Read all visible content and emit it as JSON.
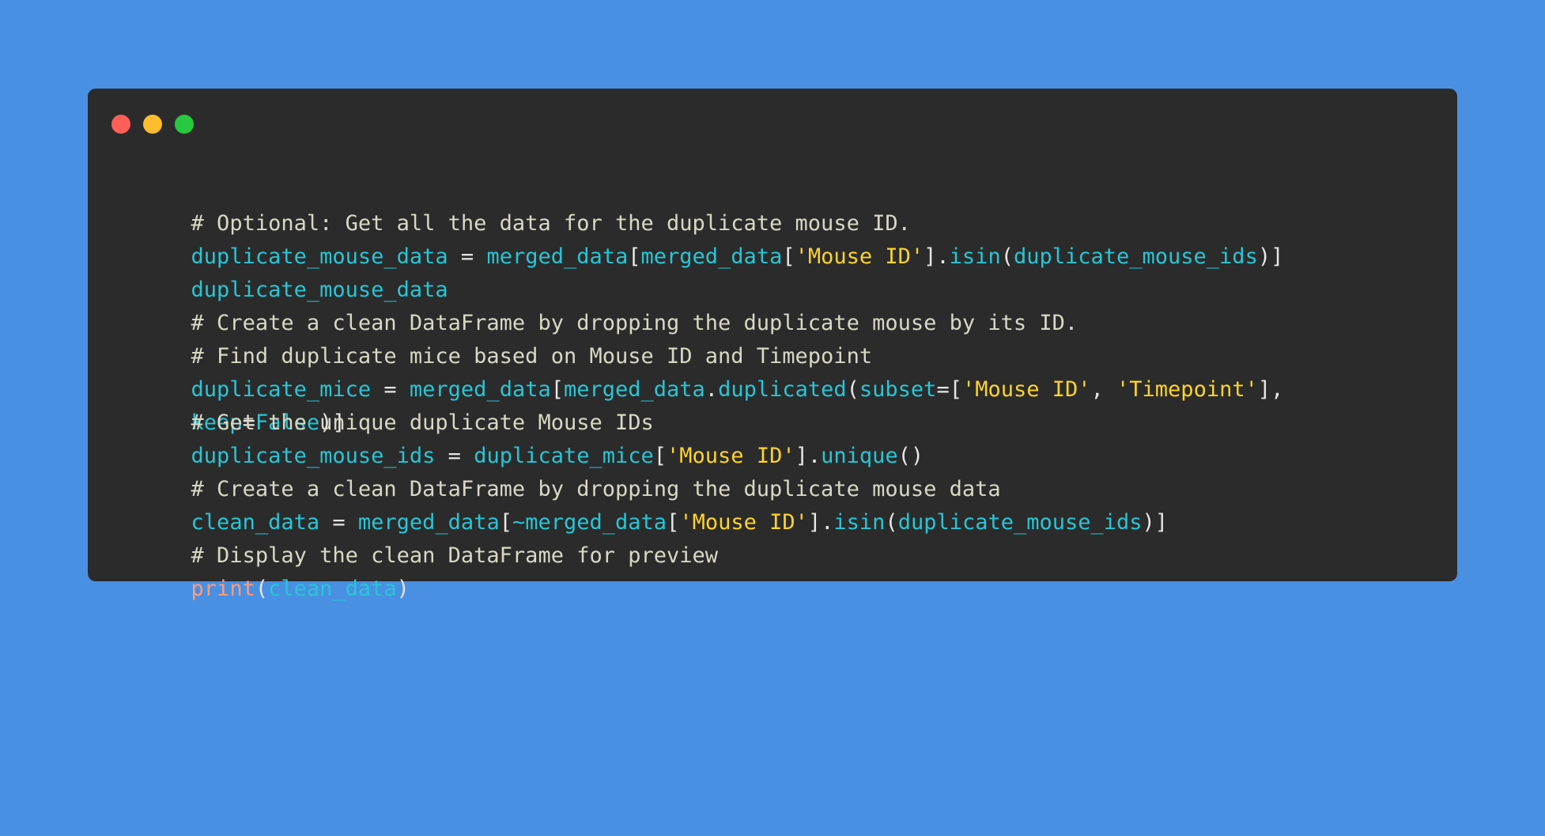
{
  "window": {
    "controls": {
      "close": "close",
      "minimize": "minimize",
      "maximize": "maximize"
    },
    "colors": {
      "background": "#4a90e2",
      "window_bg": "#2b2b2b",
      "comment": "#d8d8c6",
      "identifier": "#27c6d6",
      "string": "#ffd42a",
      "punctuation": "#e6e6e6",
      "function": "#ff9a7a"
    }
  },
  "code": {
    "l1": {
      "comment": "# Optional: Get all the data for the duplicate mouse ID."
    },
    "l2": {
      "a": "duplicate_mouse_data",
      "b": " = ",
      "c": "merged_data",
      "d": "[",
      "e": "merged_data",
      "f": "[",
      "g": "'Mouse ID'",
      "h": "].",
      "i": "isin",
      "j": "(",
      "k": "duplicate_mouse_ids",
      "l": ")]"
    },
    "l3": {
      "a": "duplicate_mouse_data"
    },
    "l4": {
      "comment": "# Create a clean DataFrame by dropping the duplicate mouse by its ID."
    },
    "l5": {
      "comment": "# Find duplicate mice based on Mouse ID and Timepoint"
    },
    "l6": {
      "a": "duplicate_mice",
      "b": " = ",
      "c": "merged_data",
      "d": "[",
      "e": "merged_data",
      "f": ".",
      "g": "duplicated",
      "h": "(",
      "i": "subset",
      "j": "=[",
      "k": "'Mouse ID'",
      "l": ", ",
      "m": "'Timepoint'",
      "n": "],"
    },
    "l7_overlap": {
      "a": "keep",
      "b": "=",
      "c": "False",
      "d": ")]"
    },
    "l7": {
      "comment": "# Get the unique duplicate Mouse IDs"
    },
    "l8": {
      "a": "duplicate_mouse_ids",
      "b": " = ",
      "c": "duplicate_mice",
      "d": "[",
      "e": "'Mouse ID'",
      "f": "].",
      "g": "unique",
      "h": "()"
    },
    "l9": {
      "comment": "# Create a clean DataFrame by dropping the duplicate mouse data"
    },
    "l10": {
      "a": "clean_data",
      "b": " = ",
      "c": "merged_data",
      "d": "[",
      "e": "~merged_data",
      "f": "[",
      "g": "'Mouse ID'",
      "h": "].",
      "i": "isin",
      "j": "(",
      "k": "duplicate_mouse_ids",
      "l": ")]"
    },
    "l11": {
      "comment": "# Display the clean DataFrame for preview"
    },
    "l12": {
      "a": "print",
      "b": "(",
      "c": "clean_data",
      "d": ")"
    }
  }
}
